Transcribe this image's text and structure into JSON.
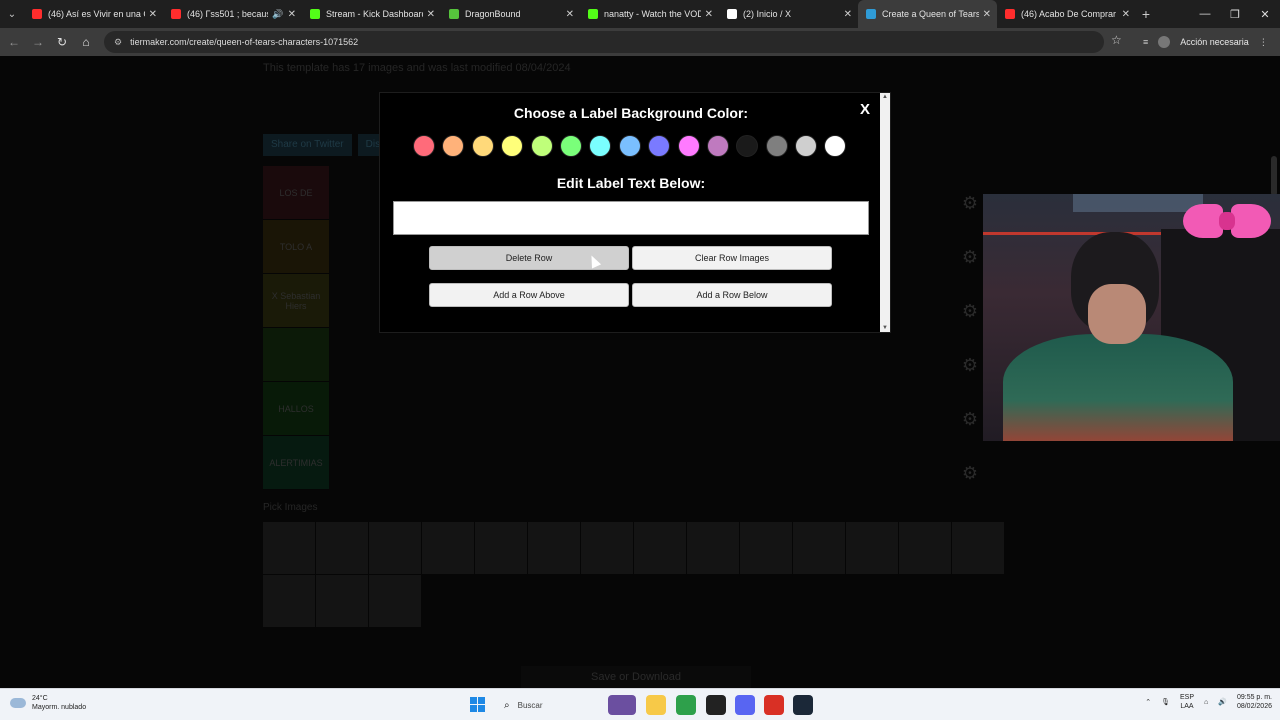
{
  "browser": {
    "tabs": [
      {
        "title": "(46) Así es Vivir en una Ca",
        "favicon_color": "#ff2d2d",
        "active": false
      },
      {
        "title": "(46) Гss501 ; because",
        "favicon_color": "#ff2d2d",
        "active": false,
        "extra_icon": "speaker-icon"
      },
      {
        "title": "Stream - Kick Dashboard",
        "favicon_color": "#53fc18",
        "active": false
      },
      {
        "title": "DragonBound",
        "favicon_color": "#56c43c",
        "active": false
      },
      {
        "title": "nanatty - Watch the VOD",
        "favicon_color": "#53fc18",
        "active": false
      },
      {
        "title": "(2) Inicio / X",
        "favicon_color": "#ffffff",
        "active": false
      },
      {
        "title": "Create a Queen of Tears",
        "favicon_color": "#2f9bd6",
        "active": true
      },
      {
        "title": "(46) Acabo De Comprar",
        "favicon_color": "#ff2d2d",
        "active": false
      }
    ],
    "url": "tiermaker.com/create/queen-of-tears-characters-1071562",
    "profile_button": "Acción necesaria"
  },
  "page": {
    "note": "This template has 17 images and was last modified 08/04/2024",
    "tabs": [
      "Share on Twitter",
      "Discord"
    ],
    "tiers": [
      "LOS DE",
      "TOLO A",
      "X Sebastian Hiers",
      "",
      "HALLOS",
      "ALERTIMIAS"
    ],
    "pick_label": "Pick Images",
    "pick_count": 17,
    "save_label": "Save or Download"
  },
  "modal": {
    "title": "Choose a Label Background Color:",
    "subtitle": "Edit Label Text Below:",
    "close_label": "X",
    "label_value": "",
    "colors": [
      "#ff6b7a",
      "#ffb27a",
      "#ffd97a",
      "#ffff7a",
      "#bfff7a",
      "#7aff7a",
      "#7affff",
      "#7abfff",
      "#7a7aff",
      "#ff7aff",
      "#bf7abf",
      "#1a1a1a",
      "#7f7f7f",
      "#cfcfcf",
      "#ffffff"
    ],
    "buttons": {
      "delete_row": "Delete Row",
      "clear_row_images": "Clear Row Images",
      "add_row_above": "Add a Row Above",
      "add_row_below": "Add a Row Below"
    }
  },
  "taskbar": {
    "weather_temp": "24°C",
    "weather_desc": "Mayorm. nublado",
    "search_placeholder": "Buscar",
    "lang_top": "ESP",
    "lang_bottom": "LAA",
    "time": "09:55 p. m.",
    "date": "08/02/2026",
    "apps": [
      {
        "name": "game-icon",
        "color": "#6b4fa0"
      },
      {
        "name": "folder-icon",
        "color": "#f7c948"
      },
      {
        "name": "chrome-icon",
        "color": "#2ea04b"
      },
      {
        "name": "xbox-icon",
        "color": "#222222"
      },
      {
        "name": "discord-icon",
        "color": "#5865f2"
      },
      {
        "name": "chrome-alt-icon",
        "color": "#d93025"
      },
      {
        "name": "steam-icon",
        "color": "#1b2838"
      }
    ]
  }
}
